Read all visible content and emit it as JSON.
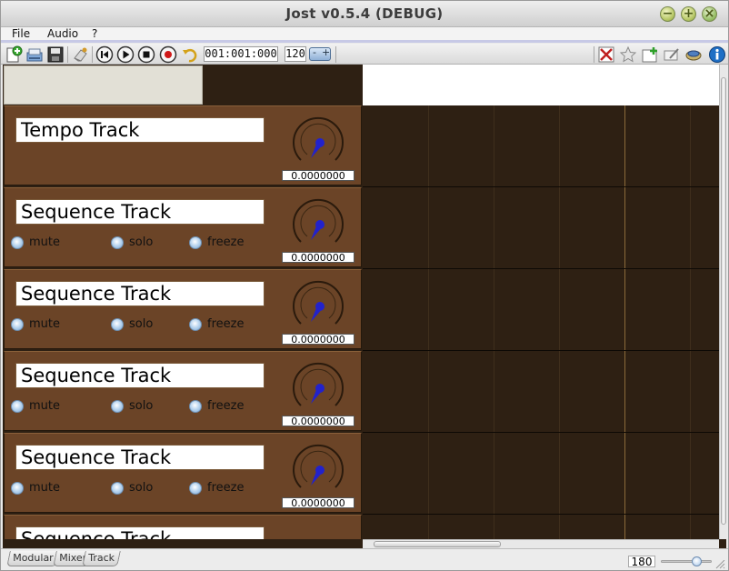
{
  "window": {
    "title": "Jost v0.5.4 (DEBUG)"
  },
  "menu": {
    "items": [
      "File",
      "Audio",
      "?"
    ]
  },
  "toolbar": {
    "position": "001:001:000",
    "tempo": "120",
    "left_icons": [
      "new-icon",
      "open-icon",
      "save-icon",
      "erase-icon",
      "rewind-icon",
      "play-icon",
      "stop-icon",
      "record-icon",
      "loop-icon"
    ],
    "right_icons": [
      "expand-icon",
      "star-icon",
      "add-track-icon",
      "edit-icon",
      "plugin-icon",
      "info-icon"
    ]
  },
  "tracks": [
    {
      "name": "Tempo Track",
      "value": "0.0000000",
      "options": []
    },
    {
      "name": "Sequence Track",
      "value": "0.0000000",
      "options": [
        "mute",
        "solo",
        "freeze"
      ]
    },
    {
      "name": "Sequence Track",
      "value": "0.0000000",
      "options": [
        "mute",
        "solo",
        "freeze"
      ]
    },
    {
      "name": "Sequence Track",
      "value": "0.0000000",
      "options": [
        "mute",
        "solo",
        "freeze"
      ]
    },
    {
      "name": "Sequence Track",
      "value": "0.0000000",
      "options": [
        "mute",
        "solo",
        "freeze"
      ]
    },
    {
      "name": "Sequence Track",
      "value": "",
      "options": []
    }
  ],
  "bottom": {
    "tabs": [
      "Modular",
      "Mixer",
      "Track"
    ],
    "zoom": "180"
  },
  "colors": {
    "lane_bg": "#6b4427",
    "grid_bg": "#2e2013",
    "knob_needle": "#2222cc"
  }
}
